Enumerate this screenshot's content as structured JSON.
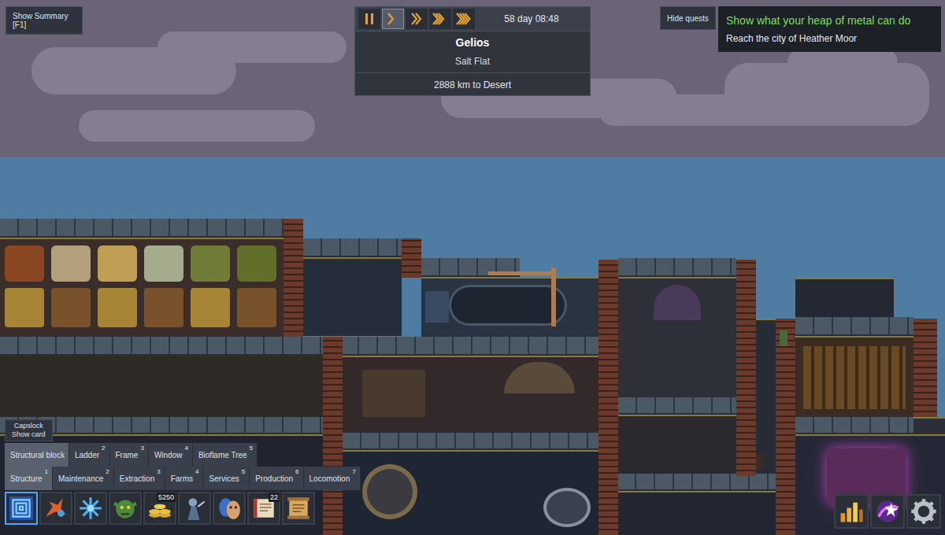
{
  "summary_button": {
    "label": "Show Summary [F1]"
  },
  "speed_controls": [
    {
      "kind": "pause",
      "selected": false
    },
    {
      "kind": "play",
      "selected": true
    },
    {
      "kind": "fast",
      "selected": false
    },
    {
      "kind": "faster",
      "selected": false
    },
    {
      "kind": "fastest",
      "selected": false
    }
  ],
  "clock": "58 day 08:48",
  "location": {
    "name": "Gelios",
    "biome": "Salt Flat",
    "distance": "2888 km to Desert"
  },
  "quests_button": {
    "label": "Hide quests"
  },
  "quest": {
    "title": "Show what your heap of metal can do",
    "objective": "Reach the city of Heather Moor"
  },
  "card_hint": {
    "key": "Capslock",
    "label": "Show card"
  },
  "subcategories": [
    {
      "label": "Structural block",
      "selected": true
    },
    {
      "label": "Ladder",
      "hotkey": "2",
      "selected": false
    },
    {
      "label": "Frame",
      "hotkey": "3",
      "selected": false
    },
    {
      "label": "Window",
      "hotkey": "4",
      "selected": false
    },
    {
      "label": "Bioflame Tree",
      "hotkey": "5",
      "selected": false
    }
  ],
  "categories": [
    {
      "label": "Structure",
      "hotkey": "1",
      "selected": true
    },
    {
      "label": "Maintenance",
      "hotkey": "2",
      "selected": false
    },
    {
      "label": "Extraction",
      "hotkey": "3",
      "selected": false
    },
    {
      "label": "Farms",
      "hotkey": "4",
      "selected": false
    },
    {
      "label": "Services",
      "hotkey": "5",
      "selected": false
    },
    {
      "label": "Production",
      "hotkey": "6",
      "selected": false
    },
    {
      "label": "Locomotion",
      "hotkey": "7",
      "selected": false
    }
  ],
  "toolbar": [
    {
      "kind": "blueprint",
      "selected": true
    },
    {
      "kind": "sparks",
      "selected": false
    },
    {
      "kind": "snowflake",
      "selected": false
    },
    {
      "kind": "goblin",
      "selected": false
    },
    {
      "kind": "coins",
      "badge": "5250",
      "selected": false
    },
    {
      "kind": "creature",
      "selected": false
    },
    {
      "kind": "masks",
      "selected": false
    },
    {
      "kind": "book",
      "badge": "22",
      "selected": false
    },
    {
      "kind": "scroll",
      "selected": false
    }
  ],
  "side_tools": [
    {
      "kind": "chart"
    },
    {
      "kind": "magic"
    },
    {
      "kind": "gear"
    }
  ]
}
